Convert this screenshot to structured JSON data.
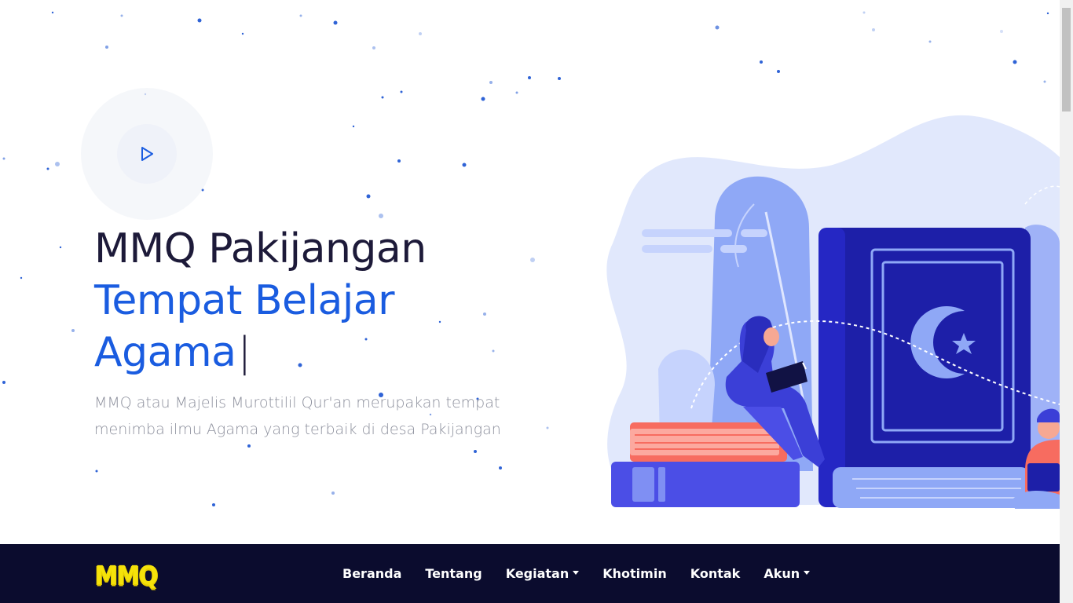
{
  "hero": {
    "title_line1": "MMQ Pakijangan",
    "title_line2": "Tempat Belajar",
    "title_line3": "Agama",
    "cursor": "|",
    "description": "MMQ atau Majelis Murottilil Qur'an merupakan tempat menimba ilmu Agama yang terbaik di desa Pakijangan",
    "play_icon": "play-icon"
  },
  "navbar": {
    "logo": "MMQ",
    "items": [
      {
        "label": "Beranda",
        "dropdown": false
      },
      {
        "label": "Tentang",
        "dropdown": false
      },
      {
        "label": "Kegiatan",
        "dropdown": true
      },
      {
        "label": "Khotimin",
        "dropdown": false
      },
      {
        "label": "Kontak",
        "dropdown": false
      },
      {
        "label": "Akun",
        "dropdown": true
      }
    ]
  },
  "colors": {
    "navbar_bg": "#0b0c2e",
    "accent_blue": "#1a5ce0",
    "title_dark": "#1d1a39",
    "logo_yellow": "#f5e20a",
    "description_gray": "#8c8f9c"
  }
}
